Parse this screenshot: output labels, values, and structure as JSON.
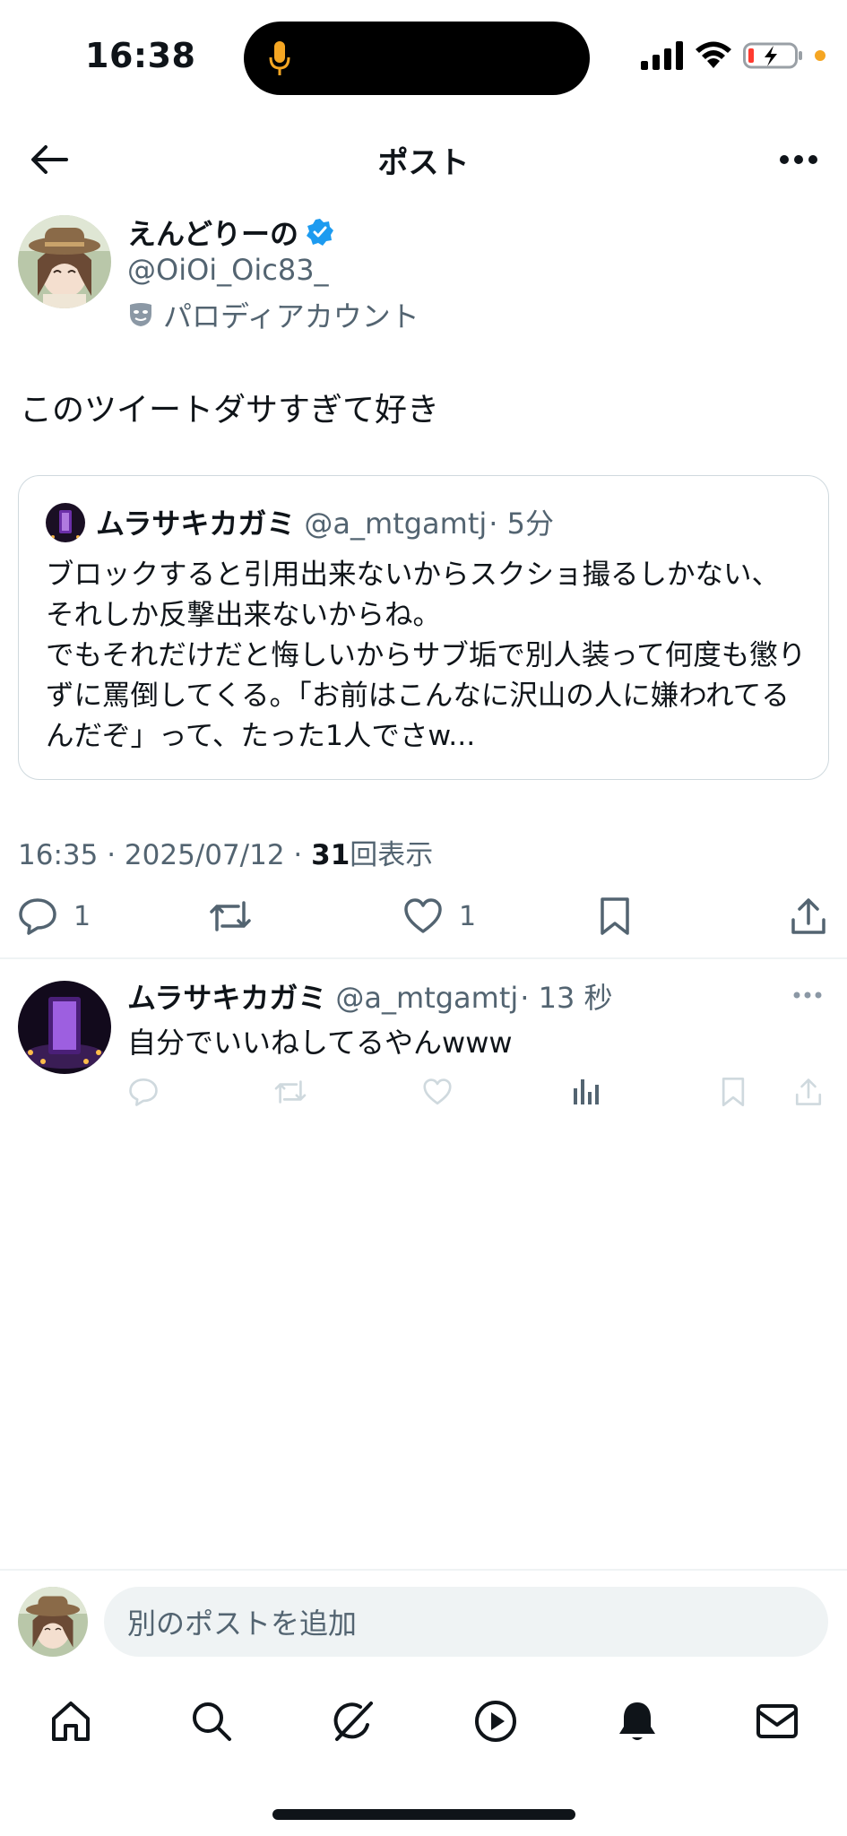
{
  "status_bar": {
    "time": "16:38"
  },
  "header": {
    "title": "ポスト"
  },
  "post": {
    "author_name": "えんどりーの",
    "author_handle": "@OiOi_Oic83_",
    "account_label": "パロディアカウント",
    "text": "このツイートダサすぎて好き",
    "timestamp": "16:35 · 2025/07/12 · ",
    "views_count": "31",
    "views_label": "回表示",
    "reply_count": "1",
    "like_count": "1"
  },
  "quote": {
    "name": "ムラサキカガミ",
    "handle": "@a_mtgamtj",
    "time": "· 5分",
    "body": "ブロックすると引用出来ないからスクショ撮るしかない、それしか反撃出来ないからね。\nでもそれだけだと悔しいからサブ垢で別人装って何度も懲りずに罵倒してくる。「お前はこんなに沢山の人に嫌われてるんだぞ」って、たった1人でさw..."
  },
  "reply": {
    "name": "ムラサキカガミ",
    "handle": "@a_mtgamtj",
    "time": "· 13 秒",
    "text": "自分でいいねしてるやんwww"
  },
  "compose": {
    "placeholder": "別のポストを追加"
  },
  "colors": {
    "verified": "#1d9bf0",
    "secondary_text": "#536471",
    "mic": "#f5a623",
    "battery_low": "#ff3b30",
    "orange_dot": "#f5a623"
  }
}
